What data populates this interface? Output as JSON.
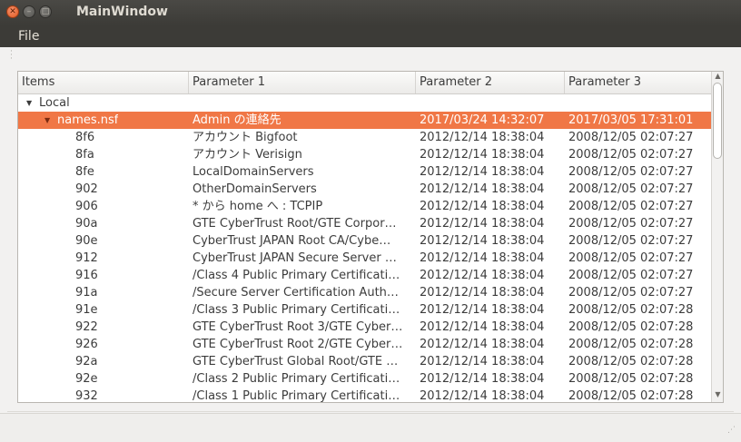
{
  "window": {
    "title": "MainWindow"
  },
  "menu": {
    "file_label": "File"
  },
  "tree": {
    "columns": [
      "Items",
      "Parameter 1",
      "Parameter 2",
      "Parameter 3"
    ],
    "root_label": "Local",
    "node_label": "names.nsf",
    "node_p1": "Admin の連絡先",
    "node_p2": "2017/03/24 14:32:07",
    "node_p3": "2017/03/05 17:31:01",
    "rows": [
      {
        "item": "8f6",
        "p1": "アカウント Bigfoot",
        "p2": "2012/12/14 18:38:04",
        "p3": "2008/12/05 02:07:27"
      },
      {
        "item": "8fa",
        "p1": "アカウント Verisign",
        "p2": "2012/12/14 18:38:04",
        "p3": "2008/12/05 02:07:27"
      },
      {
        "item": "8fe",
        "p1": "LocalDomainServers",
        "p2": "2012/12/14 18:38:04",
        "p3": "2008/12/05 02:07:27"
      },
      {
        "item": "902",
        "p1": "OtherDomainServers",
        "p2": "2012/12/14 18:38:04",
        "p3": "2008/12/05 02:07:27"
      },
      {
        "item": "906",
        "p1": "* から home へ : TCPIP",
        "p2": "2012/12/14 18:38:04",
        "p3": "2008/12/05 02:07:27"
      },
      {
        "item": "90a",
        "p1": "GTE CyberTrust Root/GTE Corpor…",
        "p2": "2012/12/14 18:38:04",
        "p3": "2008/12/05 02:07:27"
      },
      {
        "item": "90e",
        "p1": "CyberTrust JAPAN Root CA/Cybe…",
        "p2": "2012/12/14 18:38:04",
        "p3": "2008/12/05 02:07:27"
      },
      {
        "item": "912",
        "p1": "CyberTrust JAPAN Secure Server …",
        "p2": "2012/12/14 18:38:04",
        "p3": "2008/12/05 02:07:27"
      },
      {
        "item": "916",
        "p1": "/Class 4 Public Primary Certificati…",
        "p2": "2012/12/14 18:38:04",
        "p3": "2008/12/05 02:07:27"
      },
      {
        "item": "91a",
        "p1": "/Secure Server Certification Auth…",
        "p2": "2012/12/14 18:38:04",
        "p3": "2008/12/05 02:07:27"
      },
      {
        "item": "91e",
        "p1": "/Class 3 Public Primary Certificati…",
        "p2": "2012/12/14 18:38:04",
        "p3": "2008/12/05 02:07:28"
      },
      {
        "item": "922",
        "p1": "GTE CyberTrust Root 3/GTE Cyber…",
        "p2": "2012/12/14 18:38:04",
        "p3": "2008/12/05 02:07:28"
      },
      {
        "item": "926",
        "p1": "GTE CyberTrust Root 2/GTE Cyber…",
        "p2": "2012/12/14 18:38:04",
        "p3": "2008/12/05 02:07:28"
      },
      {
        "item": "92a",
        "p1": "GTE CyberTrust Global Root/GTE …",
        "p2": "2012/12/14 18:38:04",
        "p3": "2008/12/05 02:07:28"
      },
      {
        "item": "92e",
        "p1": "/Class 2 Public Primary Certificati…",
        "p2": "2012/12/14 18:38:04",
        "p3": "2008/12/05 02:07:28"
      },
      {
        "item": "932",
        "p1": "/Class 1 Public Primary Certificati…",
        "p2": "2012/12/14 18:38:04",
        "p3": "2008/12/05 02:07:28"
      }
    ]
  },
  "colors": {
    "selection": "#f07746",
    "titlebar": "#3c3b37"
  },
  "icons": [
    "close-icon",
    "minimize-icon",
    "maximize-icon",
    "expand-arrow-icon",
    "scroll-up-icon",
    "scroll-down-icon"
  ]
}
